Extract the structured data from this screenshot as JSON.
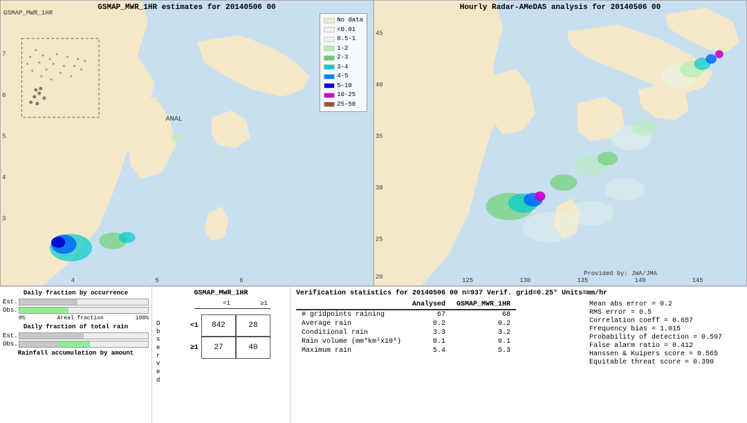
{
  "left_map": {
    "title": "GSMAP_MWR_1HR estimates for 20140506 00",
    "label": "GSMAP_MWR_1HR",
    "anal_label": "ANAL"
  },
  "right_map": {
    "title": "Hourly Radar-AMeDAS analysis for 20140506 00",
    "credit": "Provided by: JWA/JMA"
  },
  "legend": {
    "title": "",
    "items": [
      {
        "label": "No data",
        "color": "#f5e8c8"
      },
      {
        "label": "<0.01",
        "color": "#f0f0f0"
      },
      {
        "label": "0.5-1",
        "color": "#e8f5e8"
      },
      {
        "label": "1-2",
        "color": "#b0f0b0"
      },
      {
        "label": "2-3",
        "color": "#60d060"
      },
      {
        "label": "3-4",
        "color": "#00cccc"
      },
      {
        "label": "4-5",
        "color": "#0080ff"
      },
      {
        "label": "5-10",
        "color": "#0000cc"
      },
      {
        "label": "10-25",
        "color": "#cc00cc"
      },
      {
        "label": "25-50",
        "color": "#a0522d"
      }
    ]
  },
  "bottom_left": {
    "section1_title": "Daily fraction by occurrence",
    "section2_title": "Daily fraction of total rain",
    "section3_title": "Rainfall accumulation by amount",
    "est_label": "Est.",
    "obs_label": "Obs.",
    "axis_start": "0%",
    "axis_mid": "Areal fraction",
    "axis_end": "100%"
  },
  "contingency": {
    "title": "GSMAP_MWR_1HR",
    "col_lt1": "<1",
    "col_ge1": "≥1",
    "row_lt1": "<1",
    "row_ge1": "≥1",
    "obs_label": "O\nb\ns\ne\nr\nv\ne\nd",
    "val_842": "842",
    "val_28": "28",
    "val_27": "27",
    "val_40": "40"
  },
  "verification": {
    "title": "Verification statistics for 20140506 00  n=937  Verif. grid=0.25°  Units=mm/hr",
    "col_analysed": "Analysed",
    "col_gsmap": "GSMAP_MWR_1HR",
    "divider": "------------------------------------------------------------",
    "rows": [
      {
        "label": "# gridpoints raining",
        "analysed": "67",
        "gsmap": "68"
      },
      {
        "label": "Average rain",
        "analysed": "0.2",
        "gsmap": "0.2"
      },
      {
        "label": "Conditional rain",
        "analysed": "3.3",
        "gsmap": "3.2"
      },
      {
        "label": "Rain volume (mm*km²x10⁸)",
        "analysed": "0.1",
        "gsmap": "0.1"
      },
      {
        "label": "Maximum rain",
        "analysed": "5.4",
        "gsmap": "5.3"
      }
    ],
    "stats": [
      "Mean abs error = 0.2",
      "RMS error = 0.5",
      "Correlation coeff = 0.657",
      "Frequency bias = 1.015",
      "Probability of detection = 0.597",
      "False alarm ratio = 0.412",
      "Hanssen & Kuipers score = 0.565",
      "Equitable threat score = 0.390"
    ]
  },
  "axis_labels": {
    "left_map_y": [
      "7",
      "6",
      "5",
      "4",
      "3"
    ],
    "left_map_x": [
      "4",
      "5",
      "6"
    ],
    "right_map_y": [
      "45",
      "40",
      "35",
      "30",
      "25",
      "20"
    ],
    "right_map_x": [
      "125",
      "130",
      "135",
      "140",
      "145"
    ]
  }
}
